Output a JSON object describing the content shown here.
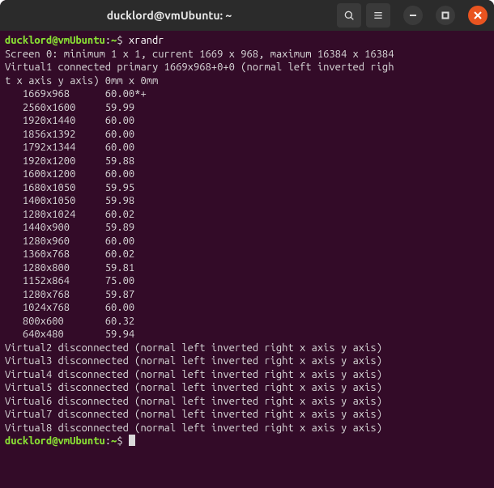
{
  "window_title": "ducklord@vmUbuntu: ~",
  "titlebar_icons": {
    "search": "search-icon",
    "menu": "menu-icon",
    "minimize": "minimize-icon",
    "maximize": "maximize-icon",
    "close": "close-icon"
  },
  "prompt1": {
    "user_host": "ducklord@vmUbuntu",
    "colon": ":",
    "path": "~",
    "dollar": "$",
    "command": "xrandr"
  },
  "screen_line": "Screen 0: minimum 1 x 1, current 1669 x 968, maximum 16384 x 16384",
  "virtual1_a": "Virtual1 connected primary 1669x968+0+0 (normal left inverted righ",
  "virtual1_b": "t x axis y axis) 0mm x 0mm",
  "modes": [
    {
      "res": "1669x968",
      "rate": "60.00*+"
    },
    {
      "res": "2560x1600",
      "rate": "59.99"
    },
    {
      "res": "1920x1440",
      "rate": "60.00"
    },
    {
      "res": "1856x1392",
      "rate": "60.00"
    },
    {
      "res": "1792x1344",
      "rate": "60.00"
    },
    {
      "res": "1920x1200",
      "rate": "59.88"
    },
    {
      "res": "1600x1200",
      "rate": "60.00"
    },
    {
      "res": "1680x1050",
      "rate": "59.95"
    },
    {
      "res": "1400x1050",
      "rate": "59.98"
    },
    {
      "res": "1280x1024",
      "rate": "60.02"
    },
    {
      "res": "1440x900",
      "rate": "59.89"
    },
    {
      "res": "1280x960",
      "rate": "60.00"
    },
    {
      "res": "1360x768",
      "rate": "60.02"
    },
    {
      "res": "1280x800",
      "rate": "59.81"
    },
    {
      "res": "1152x864",
      "rate": "75.00"
    },
    {
      "res": "1280x768",
      "rate": "59.87"
    },
    {
      "res": "1024x768",
      "rate": "60.00"
    },
    {
      "res": "800x600",
      "rate": "60.32"
    },
    {
      "res": "640x480",
      "rate": "59.94"
    }
  ],
  "disconnected": [
    "Virtual2 disconnected (normal left inverted right x axis y axis)",
    "Virtual3 disconnected (normal left inverted right x axis y axis)",
    "Virtual4 disconnected (normal left inverted right x axis y axis)",
    "Virtual5 disconnected (normal left inverted right x axis y axis)",
    "Virtual6 disconnected (normal left inverted right x axis y axis)",
    "Virtual7 disconnected (normal left inverted right x axis y axis)",
    "Virtual8 disconnected (normal left inverted right x axis y axis)"
  ],
  "prompt2": {
    "user_host": "ducklord@vmUbuntu",
    "colon": ":",
    "path": "~",
    "dollar": "$"
  }
}
